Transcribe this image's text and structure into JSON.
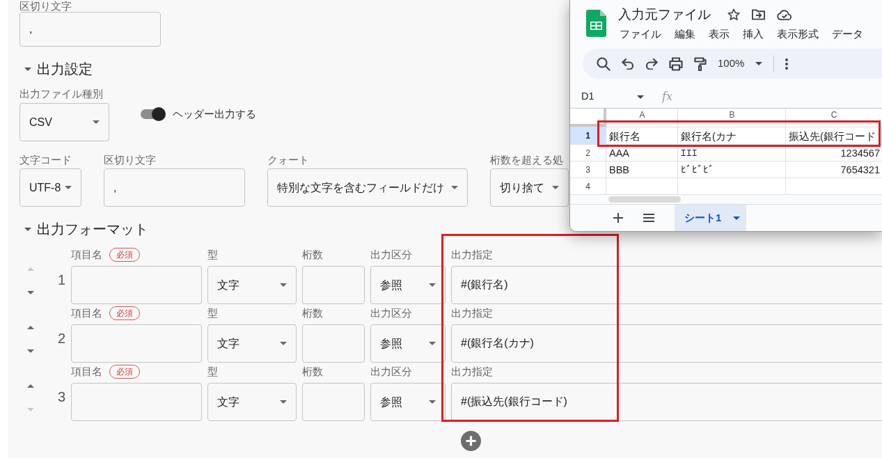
{
  "delimiter_top": {
    "label": "区切り文字",
    "value": ","
  },
  "output_settings": {
    "title": "出力設定",
    "expanded": true,
    "file_type": {
      "label": "出力ファイル種別",
      "value": "CSV"
    },
    "header_toggle": {
      "label": "ヘッダー出力する",
      "on": true
    },
    "options": [
      {
        "kind": "select",
        "label": "文字コード",
        "value": "UTF-8"
      },
      {
        "kind": "input",
        "label": "区切り文字",
        "value": ","
      },
      {
        "kind": "select",
        "label": "クォート",
        "value": "特別な文字を含むフィールドだけ"
      },
      {
        "kind": "select",
        "label": "桁数を超える処",
        "value": "切り捨て"
      }
    ]
  },
  "output_format": {
    "title": "出力フォーマット",
    "expanded": true,
    "spec_column_highlighted": true,
    "rows": [
      {
        "number": "1",
        "move_up_disabled": true,
        "move_down_disabled": false,
        "name_label": "項目名",
        "required_badge": "必須",
        "type_label": "型",
        "type_value": "文字",
        "digits_label": "桁数",
        "category_label": "出力区分",
        "category_value": "参照",
        "spec_label": "出力指定",
        "spec_value": "#(銀行名)"
      },
      {
        "number": "2",
        "move_up_disabled": false,
        "move_down_disabled": false,
        "name_label": "項目名",
        "required_badge": "必須",
        "type_label": "型",
        "type_value": "文字",
        "digits_label": "桁数",
        "category_label": "出力区分",
        "category_value": "参照",
        "spec_label": "出力指定",
        "spec_value": "#(銀行名(カナ)"
      },
      {
        "number": "3",
        "move_up_disabled": false,
        "move_down_disabled": true,
        "name_label": "項目名",
        "required_badge": "必須",
        "type_label": "型",
        "type_value": "文字",
        "digits_label": "桁数",
        "category_label": "出力区分",
        "category_value": "参照",
        "spec_label": "出力指定",
        "spec_value": "#(振込先(銀行コード)"
      }
    ]
  },
  "spreadsheet": {
    "title": "入力元ファイル",
    "menu": [
      "ファイル",
      "編集",
      "表示",
      "挿入",
      "表示形式",
      "データ"
    ],
    "zoom": "100%",
    "name_box": "D1",
    "formula_label": "fx",
    "columns": [
      "A",
      "B",
      "C"
    ],
    "rows": [
      {
        "number": "1",
        "selected": true,
        "highlighted": true,
        "cells": [
          {
            "kind": "text",
            "text": "銀行名"
          },
          {
            "kind": "text",
            "text": "銀行名(カナ"
          },
          {
            "kind": "text",
            "text": "振込先(銀行コード"
          }
        ]
      },
      {
        "number": "2",
        "selected": false,
        "highlighted": false,
        "cells": [
          {
            "kind": "text",
            "text": "AAA"
          },
          {
            "kind": "text",
            "text": "ｴｴｴ"
          },
          {
            "kind": "number",
            "text": "1234567"
          }
        ]
      },
      {
        "number": "3",
        "selected": false,
        "highlighted": false,
        "cells": [
          {
            "kind": "text",
            "text": "BBB"
          },
          {
            "kind": "text",
            "text": "ﾋﾞﾋﾞﾋﾞ"
          },
          {
            "kind": "number",
            "text": "7654321"
          }
        ]
      },
      {
        "number": "4",
        "selected": false,
        "highlighted": false
      }
    ],
    "sheet_tabs": [
      {
        "label": "シート1",
        "selected": true
      }
    ]
  }
}
